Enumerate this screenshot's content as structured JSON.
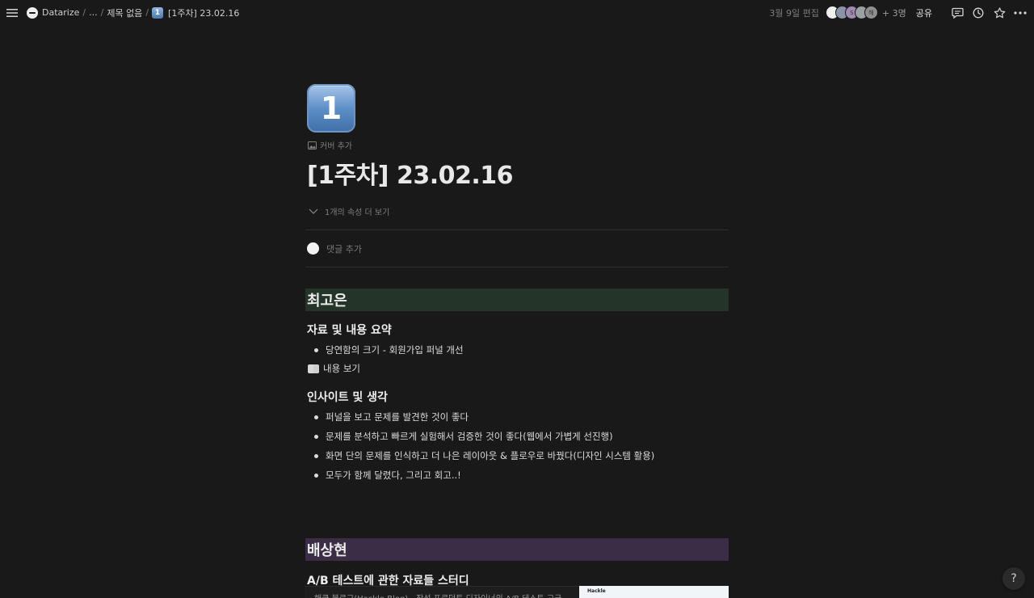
{
  "topbar": {
    "breadcrumb": [
      {
        "label": "Datarize"
      },
      {
        "label": "..."
      },
      {
        "label": "제목 없음"
      },
      {
        "label": "[1주차] 23.02.16"
      }
    ],
    "edited": "3월 9일 편집",
    "more_people": "+ 3명",
    "share": "공유",
    "avatar_initials": [
      "",
      "",
      "S",
      "",
      "해"
    ]
  },
  "page": {
    "icon_glyph": "1",
    "add_cover": "커버 추가",
    "title": "[1주차] 23.02.16",
    "properties_toggle": "1개의 속성 더 보기",
    "comment_placeholder": "댓글 추가"
  },
  "sections": {
    "s1": {
      "heading": "최고은",
      "sub1": "자료 및 내용 요약",
      "sub1_items": [
        "당연함의 크기 - 회원가입 퍼널 개선"
      ],
      "toggle": "내용 보기",
      "sub2": "인사이트 및 생각",
      "sub2_items": [
        "퍼널을 보고 문제를 발견한 것이 좋다",
        "문제를 분석하고 빠르게 실험해서 검증한 것이 좋다(웹에서 가볍게 선진행)",
        "화면 단의 문제를 인식하고 더 나은 레이아웃 & 플로우로 바꿨다(디자인 시스템 활용)",
        "모두가 함께 달렸다, 그리고 회고..!"
      ]
    },
    "s2": {
      "heading": "배상현",
      "sub1": "A/B 테스트에 관한 자료들 스터디",
      "bottom_text": "해클 블로그(Hackle Blog) - 작성 프로덕트 디자이너의 A/B 테스트 고급",
      "bottom_img_label": "Hackle"
    }
  },
  "help": "?"
}
